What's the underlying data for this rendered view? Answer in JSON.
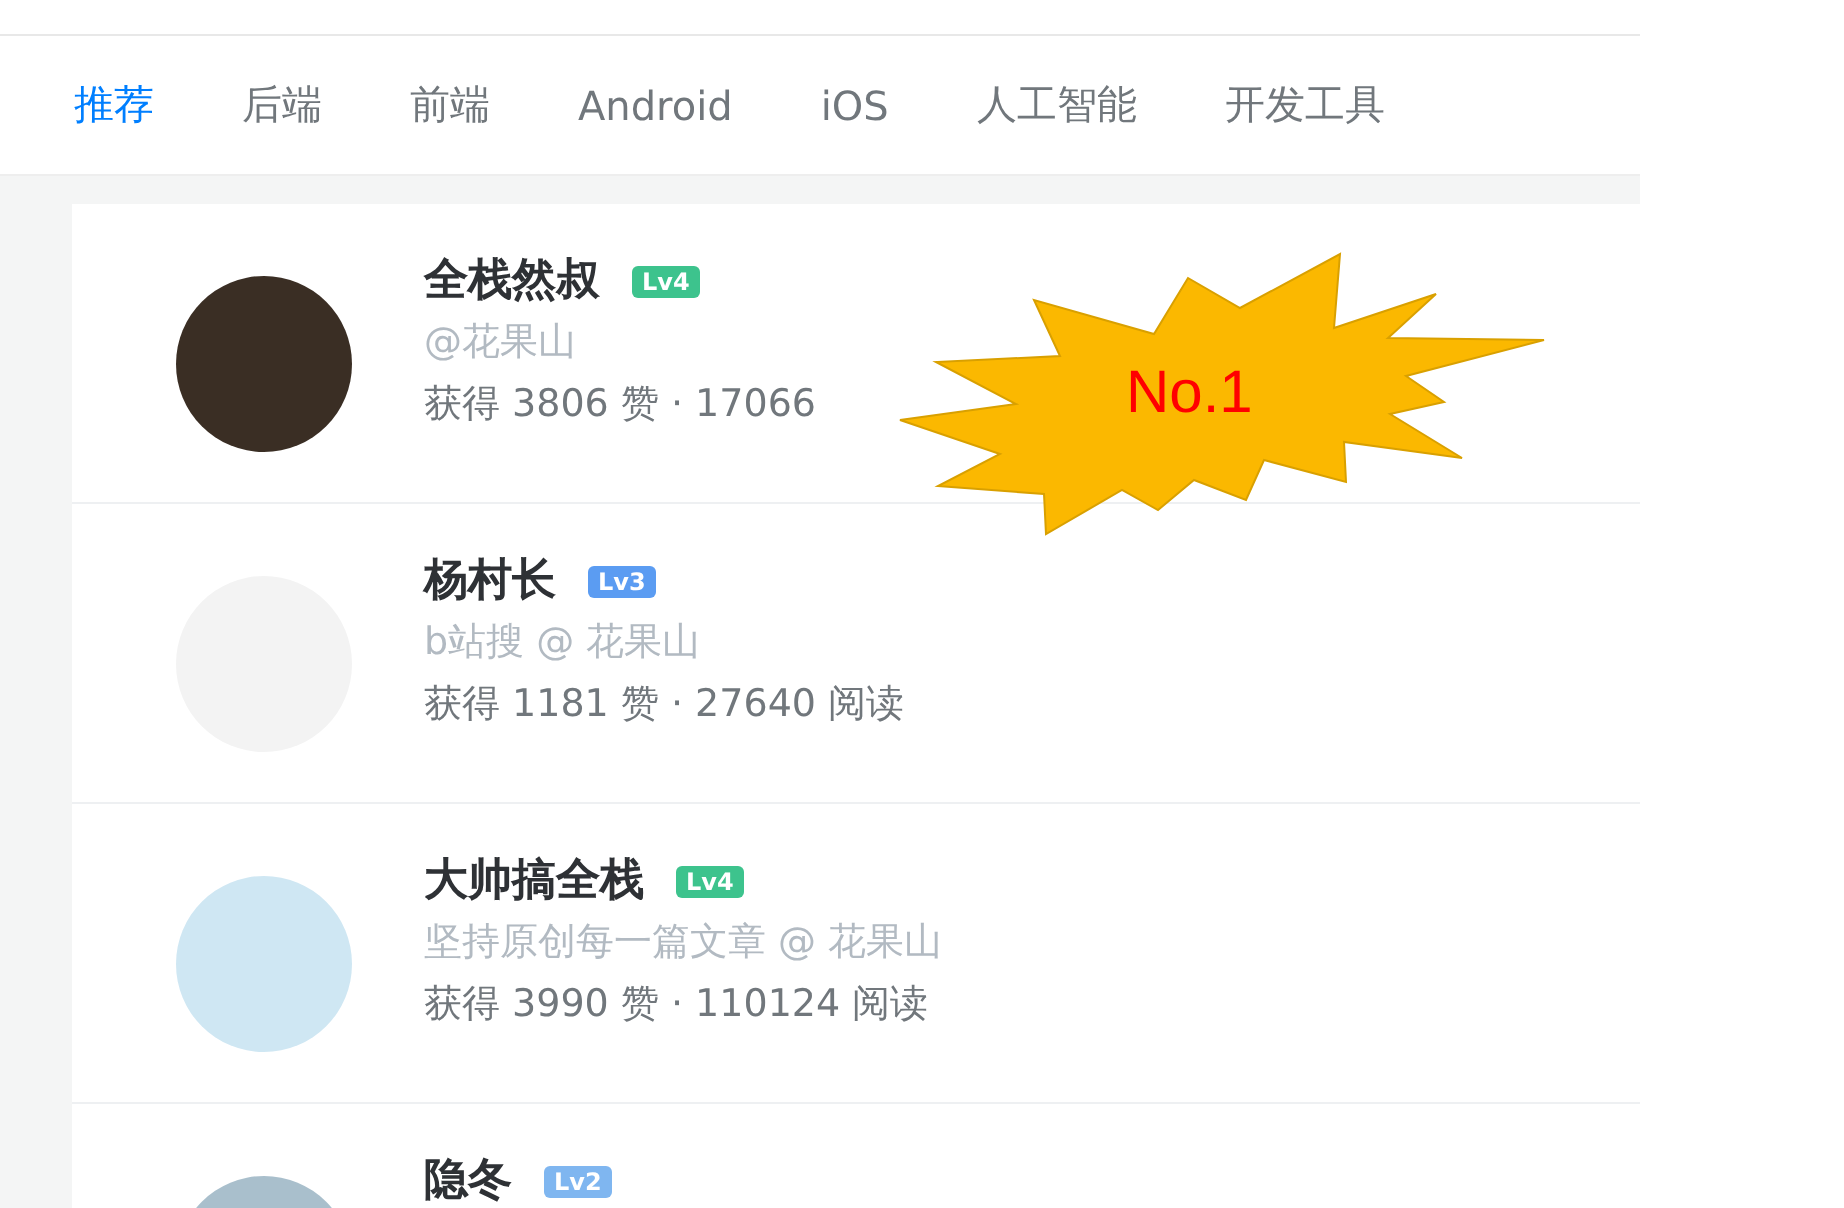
{
  "tabs": [
    {
      "label": "推荐",
      "selected": true
    },
    {
      "label": "后端",
      "selected": false
    },
    {
      "label": "前端",
      "selected": false
    },
    {
      "label": "Android",
      "selected": false
    },
    {
      "label": "iOS",
      "selected": false
    },
    {
      "label": "人工智能",
      "selected": false
    },
    {
      "label": "开发工具",
      "selected": false
    }
  ],
  "users": [
    {
      "name": "全栈然叔",
      "level": "Lv4",
      "color": "#3dc38d",
      "bio": "@花果山",
      "stats": "获得 3806 赞 · 17066"
    },
    {
      "name": "杨村长",
      "level": "Lv3",
      "color": "#5b9cf2",
      "bio": "b站搜 @ 花果山",
      "stats": "获得 1181 赞 · 27640 阅读"
    },
    {
      "name": "大帅搞全栈",
      "level": "Lv4",
      "color": "#3dc38d",
      "bio": "坚持原创每一篇文章 @ 花果山",
      "stats": "获得 3990 赞 · 110124 阅读"
    },
    {
      "name": "隐冬",
      "level": "Lv2",
      "color": "#7fb6f0"
    }
  ],
  "callout": {
    "text": "No.1"
  }
}
